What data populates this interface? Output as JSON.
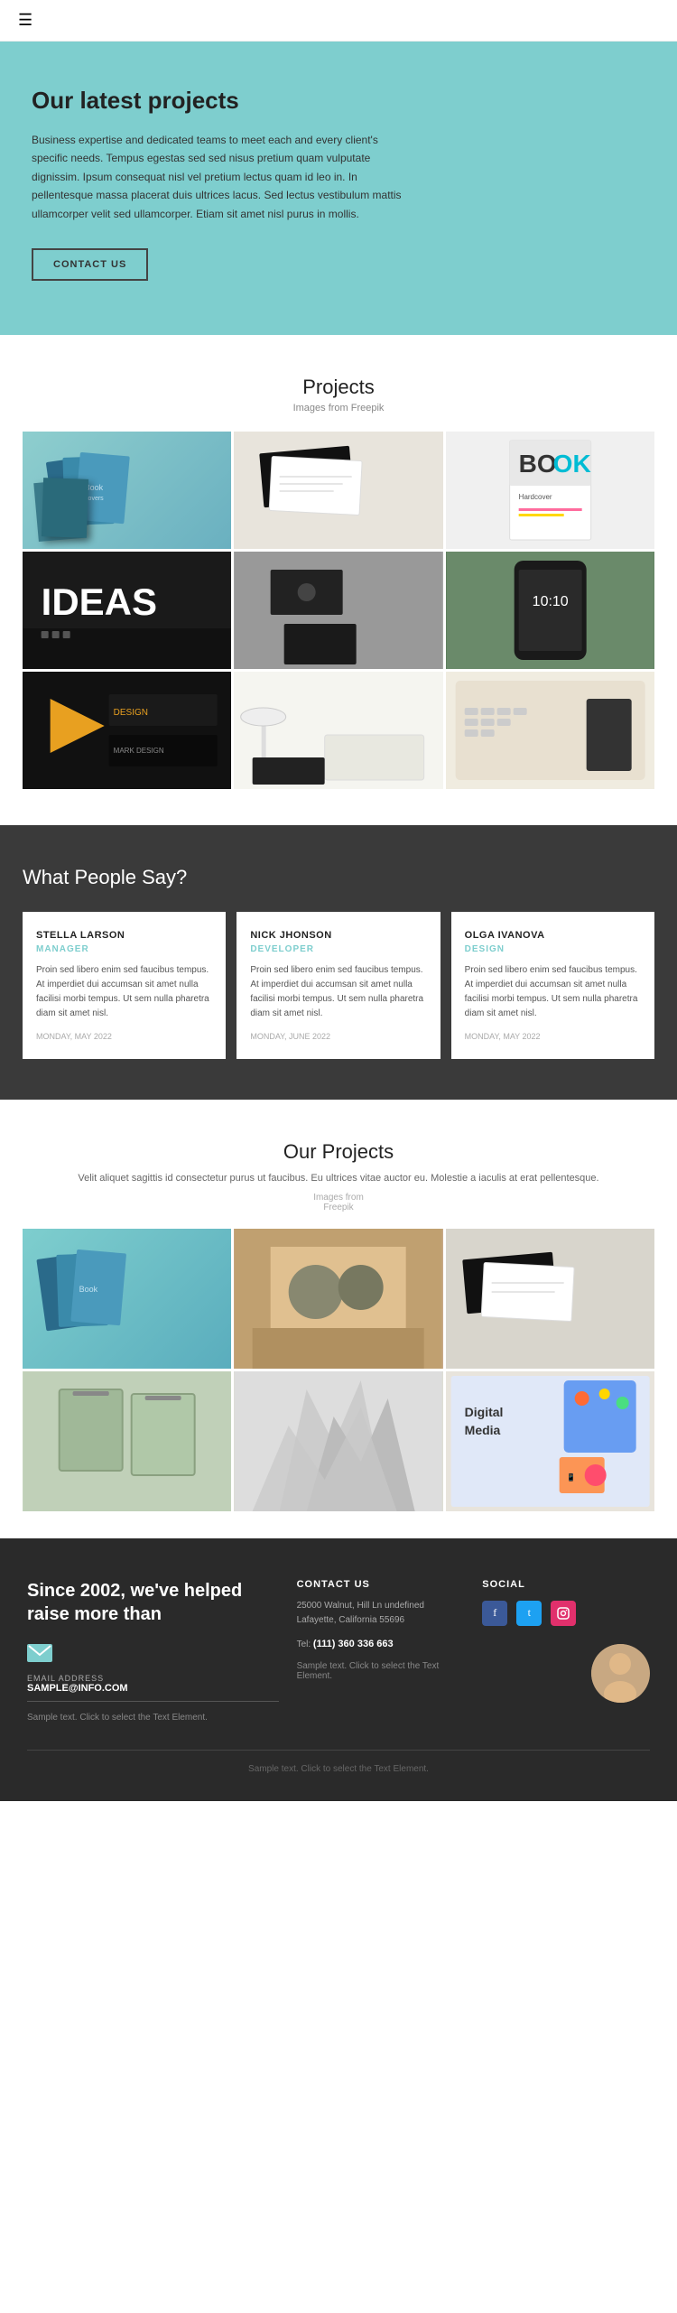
{
  "nav": {
    "hamburger": "☰"
  },
  "hero": {
    "title": "Our latest projects",
    "description": "Business expertise and dedicated teams to meet each and every client's specific needs. Tempus egestas sed sed nisus pretium quam vulputate dignissim. Ipsum consequat nisl vel pretium lectus quam id leo in. In pellentesque massa placerat duis ultrices lacus. Sed lectus vestibulum mattis ullamcorper velit sed ullamcorper. Etiam sit amet nisl purus in mollis.",
    "contact_btn": "CONTACT US"
  },
  "projects": {
    "title": "Projects",
    "subtitle": "Images from Freepik",
    "images": [
      {
        "id": 1,
        "alt": "Books on teal background"
      },
      {
        "id": 2,
        "alt": "Business cards on white"
      },
      {
        "id": 3,
        "alt": "Book cover colorful"
      },
      {
        "id": 4,
        "alt": "Laptop with IDEAS text"
      },
      {
        "id": 5,
        "alt": "Dark business cards"
      },
      {
        "id": 6,
        "alt": "Smartphone on green"
      },
      {
        "id": 7,
        "alt": "Design business cards dark"
      },
      {
        "id": 8,
        "alt": "Desk lamp and laptop"
      },
      {
        "id": 9,
        "alt": "Keyboard top view"
      }
    ]
  },
  "testimonials": {
    "title": "What People Say?",
    "items": [
      {
        "name": "STELLA LARSON",
        "role": "MANAGER",
        "text": "Proin sed libero enim sed faucibus tempus. At imperdiet dui accumsan sit amet nulla facilisi morbi tempus. Ut sem nulla pharetra diam sit amet nisl.",
        "date": "MONDAY, MAY 2022"
      },
      {
        "name": "NICK JHONSON",
        "role": "DEVELOPER",
        "text": "Proin sed libero enim sed faucibus tempus. At imperdiet dui accumsan sit amet nulla facilisi morbi tempus. Ut sem nulla pharetra diam sit amet nisl.",
        "date": "MONDAY, JUNE 2022"
      },
      {
        "name": "OLGA IVANOVA",
        "role": "DESIGN",
        "text": "Proin sed libero enim sed faucibus tempus. At imperdiet dui accumsan sit amet nulla facilisi morbi tempus. Ut sem nulla pharetra diam sit amet nisl.",
        "date": "MONDAY, MAY 2022"
      }
    ]
  },
  "our_projects": {
    "title": "Our Projects",
    "description": "Velit aliquet sagittis id consectetur purus ut faucibus. Eu ultrices vitae auctor eu. Molestie a iaculis at erat pellentesque.",
    "images_from": "Images from\nFreepik",
    "images": [
      {
        "id": 1,
        "alt": "Books on teal"
      },
      {
        "id": 2,
        "alt": "Team meeting"
      },
      {
        "id": 3,
        "alt": "Business card dark"
      },
      {
        "id": 4,
        "alt": "Shopping bags green"
      },
      {
        "id": 5,
        "alt": "White architecture"
      },
      {
        "id": 6,
        "alt": "Digital media tablet"
      }
    ]
  },
  "footer": {
    "tagline": "Since 2002, we've helped raise more than",
    "email_label": "EMAIL ADDRESS",
    "email": "SAMPLE@INFO.COM",
    "sample_text": "Sample text. Click to select the Text Element.",
    "contact_us_label": "CONTACT US",
    "address": "25000 Walnut, Hill Ln undefined Lafayette, California 55696",
    "tel_label": "Tel:",
    "tel": "(111) 360 336 663",
    "sample_text_2": "Sample text. Click to select the Text Element.",
    "social_label": "SOCIAL",
    "social_icons": [
      "f",
      "t",
      "in"
    ],
    "footer_bottom": "Sample text. Click to select the Text Element."
  }
}
